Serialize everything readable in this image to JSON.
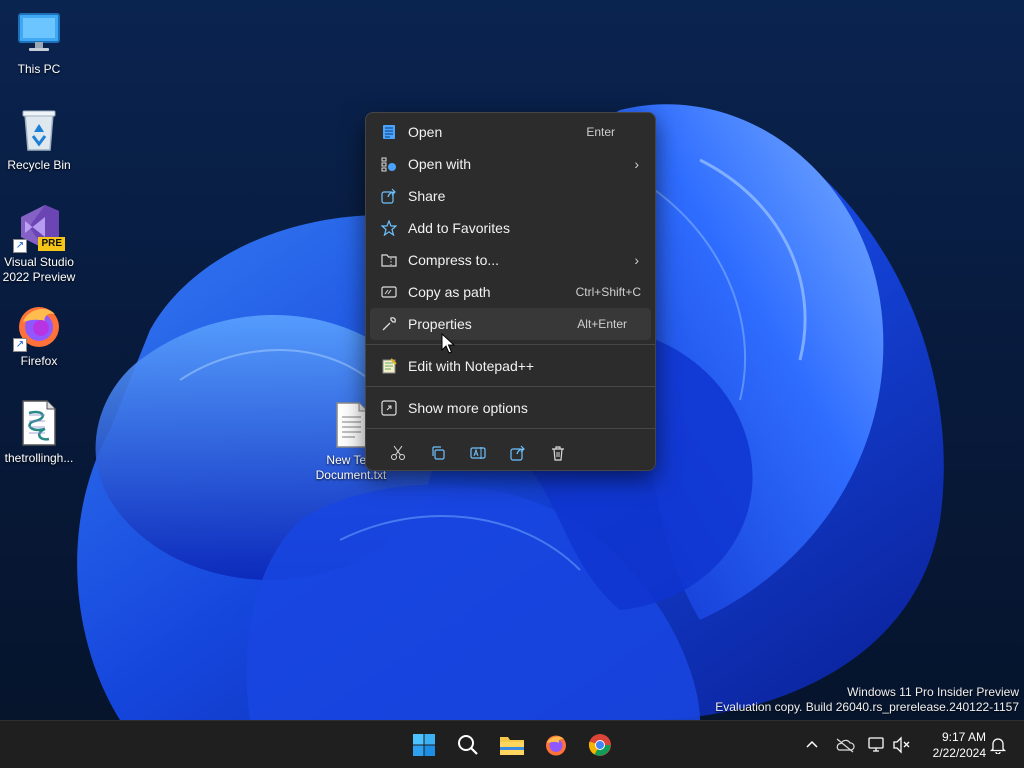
{
  "desktop": {
    "icons": [
      {
        "label": "This PC",
        "icon": "monitor-icon"
      },
      {
        "label": "Recycle Bin",
        "icon": "recycle-bin-icon"
      },
      {
        "label_line1": "Visual Studio",
        "label_line2": "2022 Preview",
        "badge": "PRE",
        "icon": "visual-studio-icon"
      },
      {
        "label": "Firefox",
        "icon": "firefox-icon"
      },
      {
        "label": "thetrollingh...",
        "icon": "script-file-icon"
      },
      {
        "label_line1": "New Text",
        "label_line2": "Document.txt",
        "icon": "text-file-icon"
      }
    ]
  },
  "context_menu": {
    "items": [
      {
        "label": "Open",
        "shortcut": "Enter",
        "icon": "notepad-icon"
      },
      {
        "label": "Open with",
        "shortcut": "",
        "icon": "open-with-icon",
        "submenu": true
      },
      {
        "label": "Share",
        "shortcut": "",
        "icon": "share-icon"
      },
      {
        "label": "Add to Favorites",
        "shortcut": "",
        "icon": "star-icon"
      },
      {
        "label": "Compress to...",
        "shortcut": "",
        "icon": "zip-folder-icon",
        "submenu": true
      },
      {
        "label": "Copy as path",
        "shortcut": "Ctrl+Shift+C",
        "icon": "copy-path-icon"
      },
      {
        "label": "Properties",
        "shortcut": "Alt+Enter",
        "icon": "wrench-icon",
        "hovered": true
      },
      {
        "label": "Edit with Notepad++",
        "shortcut": "",
        "icon": "notepadpp-icon"
      },
      {
        "label": "Show more options",
        "shortcut": "",
        "icon": "show-more-icon"
      }
    ],
    "quick_actions": [
      "cut-icon",
      "copy-icon",
      "rename-icon",
      "share-icon",
      "delete-icon"
    ]
  },
  "watermark": {
    "line1": "Windows 11 Pro Insider Preview",
    "line2": "Evaluation copy. Build 26040.rs_prerelease.240122-1157"
  },
  "taskbar": {
    "apps": [
      "windows-start-icon",
      "search-icon",
      "file-explorer-icon",
      "firefox-icon",
      "chrome-icon"
    ],
    "tray": [
      "chevron-up-icon",
      "onedrive-offline-icon",
      "network-icon",
      "volume-muted-icon",
      "notification-bell-icon"
    ],
    "time": "9:17 AM",
    "date": "2/22/2024"
  },
  "colors": {
    "menu_bg": "#2c2c2c",
    "menu_hover": "#383838",
    "accent": "#4cc2ff",
    "taskbar_bg": "#1f1f1f"
  }
}
